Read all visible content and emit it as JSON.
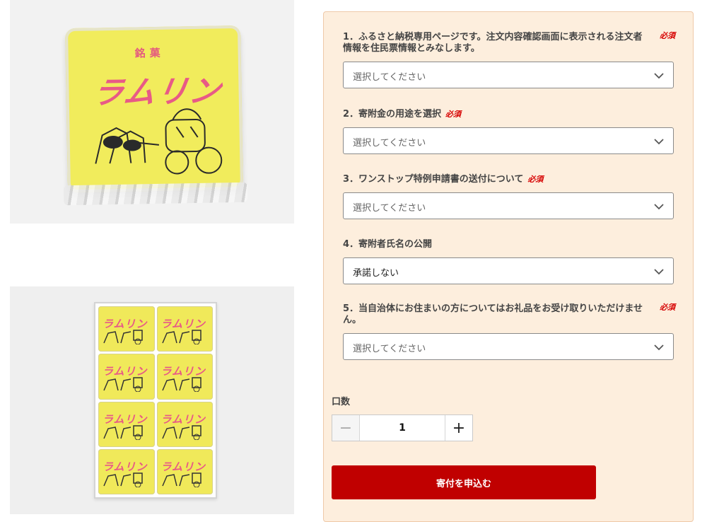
{
  "product": {
    "label_small": "銘菓",
    "brand": "ラムリン"
  },
  "form": {
    "required_label": "必須",
    "questions": [
      {
        "title": "1．ふるさと納税専用ページです。注文内容確認画面に表示される注文者情報を住民票情報とみなします。",
        "value": "選択してください",
        "required": true
      },
      {
        "title": "2．寄附金の用途を選択",
        "value": "選択してください",
        "required": true
      },
      {
        "title": "3．ワンストップ特例申請書の送付について",
        "value": "選択してください",
        "required": true
      },
      {
        "title": "4．寄附者氏名の公開",
        "value": "承諾しない",
        "required": false
      },
      {
        "title": "5．当自治体にお住まいの方についてはお礼品をお受け取りいただけません。",
        "value": "選択してください",
        "required": true
      }
    ],
    "quantity_label": "口数",
    "quantity": "1",
    "minus": "−",
    "plus": "+",
    "submit_label": "寄付を申込む"
  },
  "icons": {
    "chevron": "chevron-down-icon",
    "minus": "minus-icon",
    "plus": "plus-icon"
  },
  "colors": {
    "panel_bg": "#fdeedd",
    "required": "#d60000",
    "submit_bg": "#c00000"
  }
}
